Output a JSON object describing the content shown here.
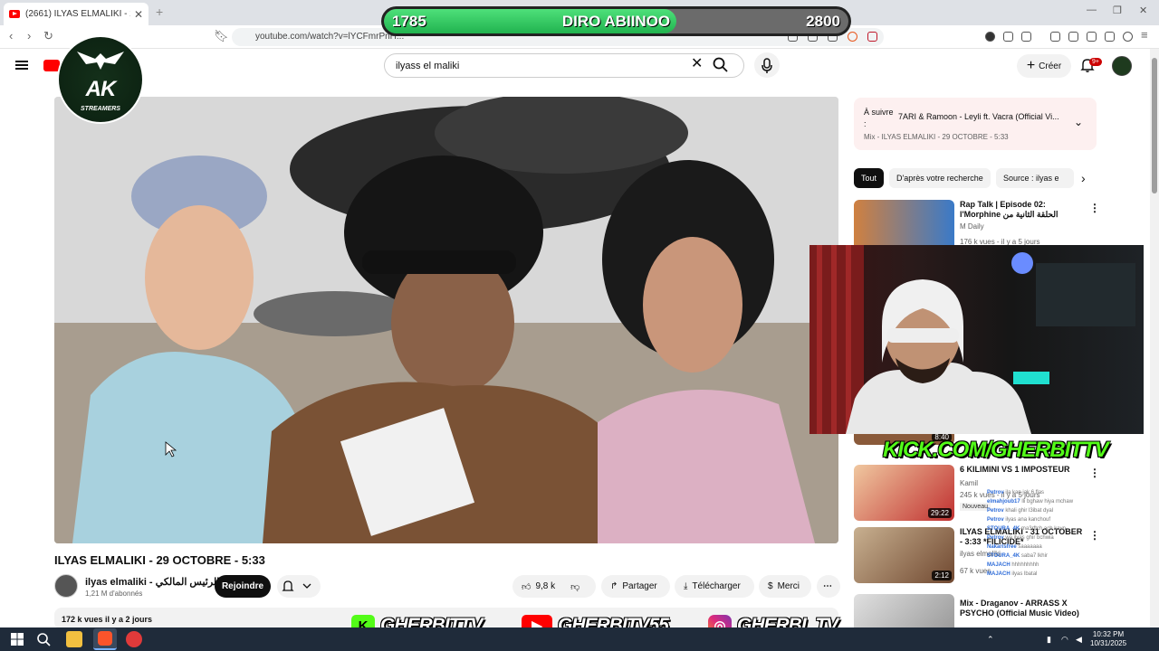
{
  "browser": {
    "tab_title": "(2661) ILYAS ELMALIKI - 29 OCTO...",
    "url": "youtube.com/watch?v=lYCFmrPnH..."
  },
  "stream_overlay": {
    "score_left": "1785",
    "song": "DIRO ABIINOO",
    "score_right": "2800",
    "progress_fraction": 0.63,
    "logo_text": "AK",
    "logo_sub": "STREAMERS",
    "kick_url": "KICK.COM/GHERBITTV",
    "socials": [
      {
        "label": "GHERBITTV",
        "icon": "kick-icon",
        "color": "#53fc18"
      },
      {
        "label": "GHERBITV55",
        "icon": "youtube-icon",
        "color": "#ff0000"
      },
      {
        "label": "GHERBI_TV",
        "icon": "instagram-icon",
        "color": "#d62976"
      }
    ]
  },
  "youtube": {
    "search_value": "ilyass el maliki",
    "create_label": "Créer",
    "notif_badge": "9+"
  },
  "video": {
    "title": "ILYAS ELMALIKI - 29 OCTOBRE - 5:33",
    "channel": "ilyas elmaliki - الرئيس المالكي",
    "subscribers": "1,21 M d'abonnés",
    "join_label": "Rejoindre",
    "likes": "9,8 k",
    "share_label": "Partager",
    "download_label": "Télécharger",
    "thanks_label": "Merci",
    "views_date": "172 k vues  il y a 2 jours"
  },
  "up_next": {
    "prefix": "À suivre :",
    "title": "7ARI & Ramoon - Leyli ft. Vacra (Official Vi...",
    "playlist": "Mix - ILYAS ELMALIKI - 29 OCTOBRE - 5:33"
  },
  "chips": [
    "Tout",
    "D'après votre recherche",
    "Source : ilyas e"
  ],
  "recommendations": [
    {
      "title": "Rap Talk | Episode 02: l'Morphine الحلقة الثانية من بودكاست ...",
      "channel": "M Daily",
      "meta": "176 k vues - il y a 5 jours",
      "duration": "",
      "badge": ""
    },
    {
      "title": "6 KILIMINI VS 1 IMPOSTEUR",
      "channel": "Kamil",
      "meta": "245 k vues - il y a 5 jours",
      "duration": "29:22",
      "badge": "Nouveau"
    },
    {
      "title": "ILYAS ELMALIKI - 31 OCTOBER - 3:33 *FILICIDE*",
      "channel": "ilyas elmaliki",
      "meta": "67 k vues",
      "duration": "2:12",
      "badge": ""
    },
    {
      "title": "Mix - Draganov - ARRASS X PSYCHO (Official Music Video)",
      "channel": "",
      "meta": "",
      "duration": "",
      "badge": ""
    }
  ],
  "partial_rec_duration": "8:40",
  "chat": [
    {
      "user": "Petrov",
      "msg": "ila kan jak 6 flas"
    },
    {
      "user": "elmahjoub17",
      "msg": "lli bghaw hiya mchaw"
    },
    {
      "user": "Petrov",
      "msg": "khali ghir l3ibat dyal"
    },
    {
      "user": "Petrov",
      "msg": "ilyas ana kanchouf"
    },
    {
      "user": "STOURA_4K",
      "msg": "ma3rftch ach kayn"
    },
    {
      "user": "Petrov",
      "msg": "wa ilyas ghir bchwia"
    },
    {
      "user": "Nakarisfree",
      "msg": "saaaaaaa"
    },
    {
      "user": "STOURA_4K",
      "msg": "saba7 lkhir"
    },
    {
      "user": "MAJACH",
      "msg": "hhhhhhhhh"
    },
    {
      "user": "MAJACH",
      "msg": "ilyas lbatal"
    }
  ],
  "taskbar": {
    "time": "10:32 PM",
    "date": "10/31/2025"
  }
}
